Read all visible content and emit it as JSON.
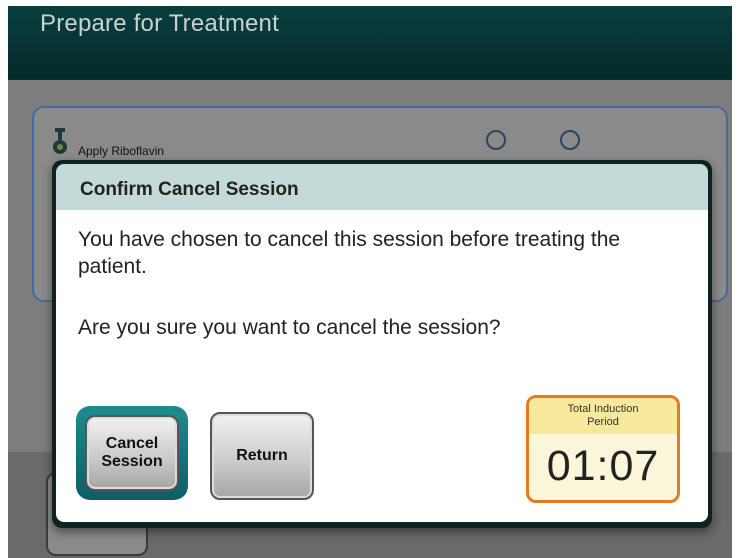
{
  "screen": {
    "title": "Prepare for Treatment"
  },
  "background_card": {
    "step_label": "Apply Riboflavin",
    "step_icon": "dropper-icon"
  },
  "dialog": {
    "title": "Confirm Cancel Session",
    "message_line1": "You have chosen to cancel this session before treating the patient.",
    "message_line2": "Are you sure you want to cancel the session?",
    "cancel_label": "Cancel Session",
    "return_label": "Return",
    "timer": {
      "label": "Total Induction Period",
      "value": "01:07"
    }
  },
  "colors": {
    "header_bg": "#0a3f3f",
    "dialog_header_bg": "#c3dad9",
    "cancel_ring": "#1e8b90",
    "timer_border": "#e57a1e",
    "timer_fill": "#fbf6d9"
  }
}
